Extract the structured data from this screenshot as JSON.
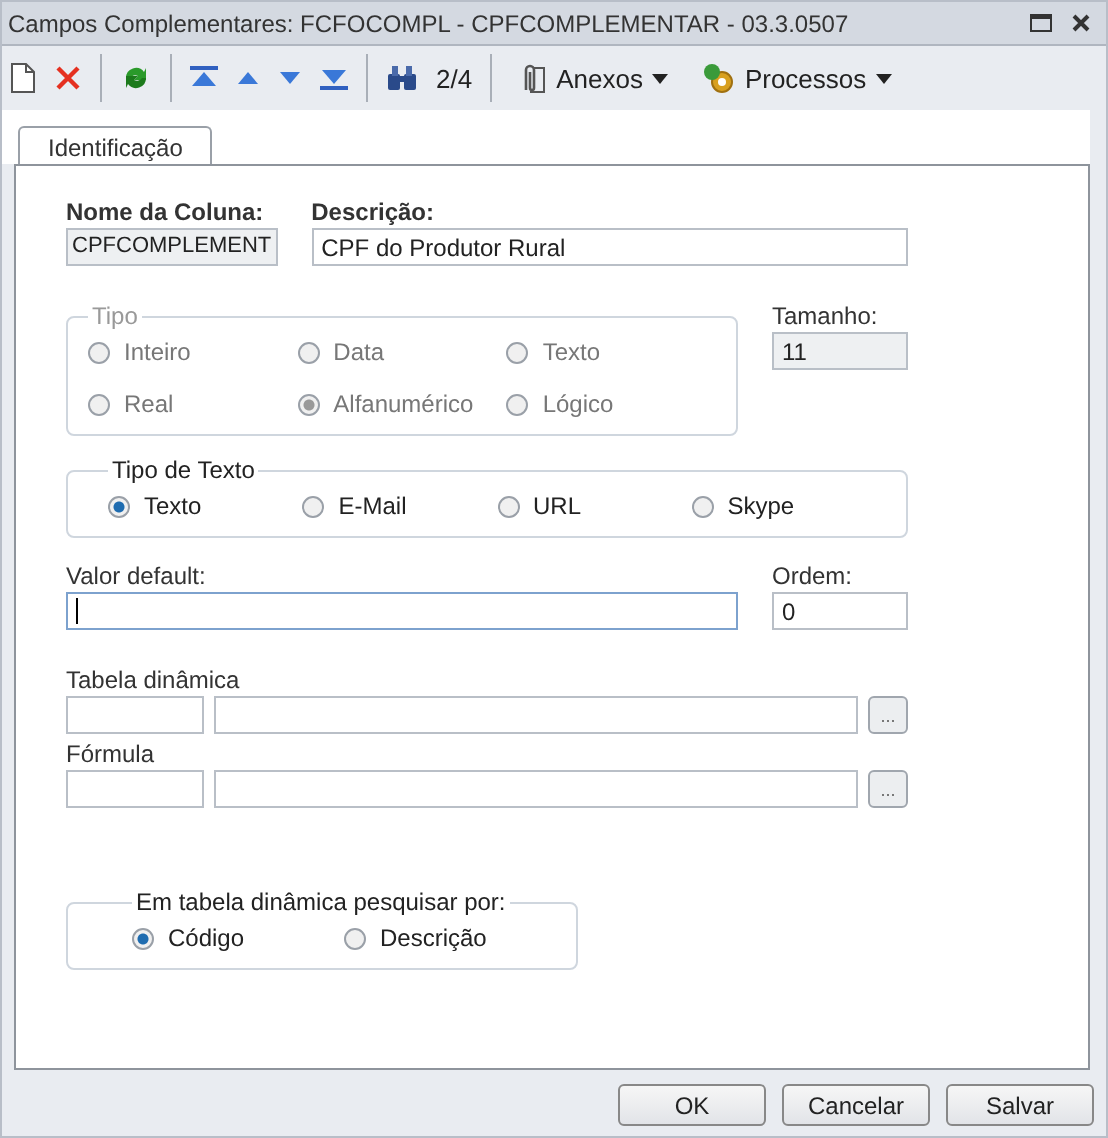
{
  "window": {
    "title": "Campos Complementares: FCFOCOMPL - CPFCOMPLEMENTAR - 03.3.0507"
  },
  "toolbar": {
    "record_position": "2/4",
    "menus": [
      {
        "kind": "attach",
        "label": "Anexos"
      },
      {
        "kind": "process",
        "label": "Processos"
      }
    ]
  },
  "tabs": [
    {
      "label": "Identificação",
      "selected": true
    }
  ],
  "form": {
    "column_name": {
      "label": "Nome da Coluna:",
      "value": "CPFCOMPLEMENT"
    },
    "description": {
      "label": "Descrição:",
      "value": "CPF do Produtor Rural"
    },
    "type_group": {
      "title": "Tipo",
      "disabled": true,
      "options": [
        {
          "label": "Inteiro",
          "selected": false
        },
        {
          "label": "Data",
          "selected": false
        },
        {
          "label": "Texto",
          "selected": false
        },
        {
          "label": "Real",
          "selected": false
        },
        {
          "label": "Alfanumérico",
          "selected": true
        },
        {
          "label": "Lógico",
          "selected": false
        }
      ]
    },
    "size": {
      "label": "Tamanho:",
      "value": "11"
    },
    "text_type_group": {
      "title": "Tipo de Texto",
      "disabled": false,
      "options": [
        {
          "label": "Texto",
          "selected": true
        },
        {
          "label": "E-Mail",
          "selected": false
        },
        {
          "label": "URL",
          "selected": false
        },
        {
          "label": "Skype",
          "selected": false
        }
      ]
    },
    "default_value": {
      "label": "Valor default:",
      "focused": true
    },
    "order": {
      "label": "Ordem:",
      "value": "0"
    },
    "lookup_table": {
      "label": "Tabela dinâmica",
      "button": "..."
    },
    "formula": {
      "label": "Fórmula",
      "button": "..."
    },
    "search_group": {
      "title": "Em tabela dinâmica pesquisar por:",
      "disabled": false,
      "options": [
        {
          "label": "Código",
          "selected": true
        },
        {
          "label": "Descrição",
          "selected": false
        }
      ]
    }
  },
  "buttons": [
    "OK",
    "Cancelar",
    "Salvar"
  ]
}
